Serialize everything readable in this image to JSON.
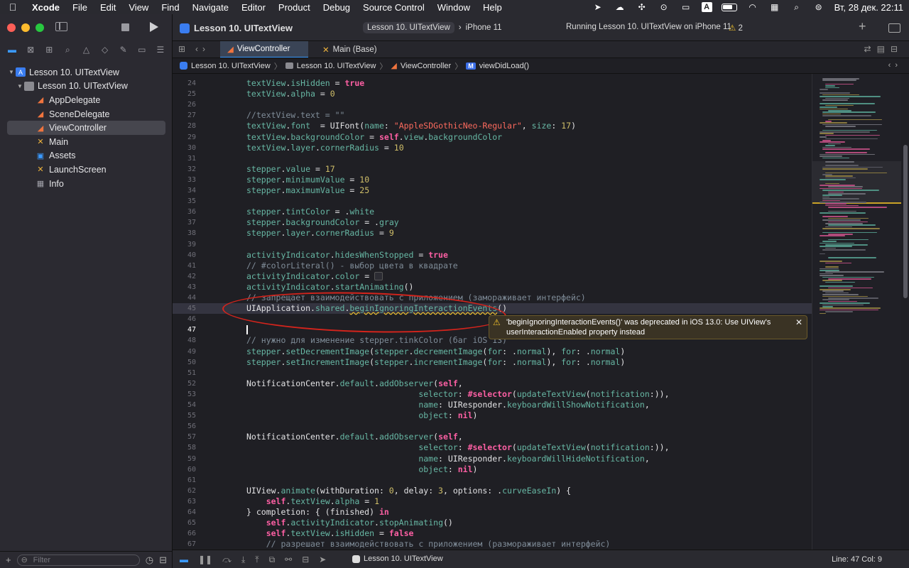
{
  "menubar": {
    "app": "Xcode",
    "items": [
      "File",
      "Edit",
      "View",
      "Find",
      "Navigate",
      "Editor",
      "Product",
      "Debug",
      "Source Control",
      "Window",
      "Help"
    ],
    "input_badge": "A",
    "datetime": "Вт, 28 дек.  22:11"
  },
  "sidebar": {
    "tree": [
      {
        "label": "Lesson 10. UITextView",
        "icon": "project-icon",
        "disclosure": "▼"
      },
      {
        "label": "Lesson 10. UITextView",
        "icon": "folder-icon",
        "disclosure": "▼"
      },
      {
        "label": "AppDelegate",
        "icon": "swift-file-icon"
      },
      {
        "label": "SceneDelegate",
        "icon": "swift-file-icon"
      },
      {
        "label": "ViewController",
        "icon": "swift-file-icon",
        "selected": true
      },
      {
        "label": "Main",
        "icon": "storyboard-icon"
      },
      {
        "label": "Assets",
        "icon": "assets-icon"
      },
      {
        "label": "LaunchScreen",
        "icon": "storyboard-icon"
      },
      {
        "label": "Info",
        "icon": "plist-icon"
      }
    ],
    "filter_placeholder": "Filter"
  },
  "toolbar": {
    "project_title": "Lesson 10. UITextView",
    "scheme": "Lesson 10. UITextView",
    "device": "iPhone 11",
    "status": "Running Lesson 10. UITextView on iPhone 11",
    "warnings": "2"
  },
  "tabs": {
    "active": "ViewController",
    "other": "Main (Base)"
  },
  "breadcrumb": {
    "items": [
      "Lesson 10. UITextView",
      "Lesson 10. UITextView",
      "ViewController",
      "viewDidLoad()"
    ],
    "method_badge": "M"
  },
  "code_lines": [
    {
      "n": "24",
      "html": "<span class='prop'>textView</span>.<span class='prop'>isHidden</span> = <span class='kw'>true</span>"
    },
    {
      "n": "25",
      "html": "<span class='prop'>textView</span>.<span class='prop'>alpha</span> = <span class='num'>0</span>"
    },
    {
      "n": "26",
      "html": ""
    },
    {
      "n": "27",
      "html": "<span class='cmt'>//textView.text = \"\"</span>"
    },
    {
      "n": "28",
      "html": "<span class='prop'>textView</span>.<span class='prop'>font</span>  = UIFont(<span class='fn'>name</span>: <span class='str'>\"AppleSDGothicNeo-Regular\"</span>, <span class='fn'>size</span>: <span class='num'>17</span>)"
    },
    {
      "n": "29",
      "html": "<span class='prop'>textView</span>.<span class='prop'>backgroundColor</span> = <span class='kw'>self</span>.<span class='prop'>view</span>.<span class='prop'>backgroundColor</span>"
    },
    {
      "n": "30",
      "html": "<span class='prop'>textView</span>.<span class='prop'>layer</span>.<span class='prop'>cornerRadius</span> = <span class='num'>10</span>"
    },
    {
      "n": "31",
      "html": ""
    },
    {
      "n": "32",
      "html": "<span class='prop'>stepper</span>.<span class='prop'>value</span> = <span class='num'>17</span>"
    },
    {
      "n": "33",
      "html": "<span class='prop'>stepper</span>.<span class='prop'>minimumValue</span> = <span class='num'>10</span>"
    },
    {
      "n": "34",
      "html": "<span class='prop'>stepper</span>.<span class='prop'>maximumValue</span> = <span class='num'>25</span>"
    },
    {
      "n": "35",
      "html": ""
    },
    {
      "n": "36",
      "html": "<span class='prop'>stepper</span>.<span class='prop'>tintColor</span> = .<span class='prop'>white</span>"
    },
    {
      "n": "37",
      "html": "<span class='prop'>stepper</span>.<span class='prop'>backgroundColor</span> = .<span class='prop'>gray</span>"
    },
    {
      "n": "38",
      "html": "<span class='prop'>stepper</span>.<span class='prop'>layer</span>.<span class='prop'>cornerRadius</span> = <span class='num'>9</span>"
    },
    {
      "n": "39",
      "html": ""
    },
    {
      "n": "40",
      "html": "<span class='prop'>activityIndicator</span>.<span class='prop'>hidesWhenStopped</span> = <span class='kw'>true</span>"
    },
    {
      "n": "41",
      "html": "<span class='cmt'>// #colorLiteral() - выбор цвета в квадрате</span>"
    },
    {
      "n": "42",
      "html": "<span class='prop'>activityIndicator</span>.<span class='prop'>color</span> = <span class='colorwell'></span>"
    },
    {
      "n": "43",
      "html": "<span class='prop'>activityIndicator</span>.<span class='fn'>startAnimating</span>()"
    },
    {
      "n": "44",
      "html": "<span class='cmt'>// запрещает взаимодействовать с приложением (замораживает интерфейс)</span>"
    },
    {
      "n": "45",
      "html": "UIApplication.<span class='prop'>shared</span>.<span class='fn' style='text-decoration:underline wavy #f3c32b'>beginIgnoringInteractionEvents</span>()",
      "hl": true
    },
    {
      "n": "46",
      "html": ""
    },
    {
      "n": "47",
      "html": "<span class='cursor'></span>",
      "cur": true
    },
    {
      "n": "48",
      "html": "<span class='cmt'>// нужно для изменение stepper.tinkColor (баг iOS 13)</span>"
    },
    {
      "n": "49",
      "html": "<span class='prop'>stepper</span>.<span class='fn'>setDecrementImage</span>(<span class='prop'>stepper</span>.<span class='fn'>decrementImage</span>(<span class='fn'>for</span>: .<span class='prop'>normal</span>), <span class='fn'>for</span>: .<span class='prop'>normal</span>)"
    },
    {
      "n": "50",
      "html": "<span class='prop'>stepper</span>.<span class='fn'>setIncrementImage</span>(<span class='prop'>stepper</span>.<span class='fn'>incrementImage</span>(<span class='fn'>for</span>: .<span class='prop'>normal</span>), <span class='fn'>for</span>: .<span class='prop'>normal</span>)"
    },
    {
      "n": "51",
      "html": ""
    },
    {
      "n": "52",
      "html": "NotificationCenter.<span class='prop'>default</span>.<span class='fn'>addObserver</span>(<span class='kw'>self</span>,"
    },
    {
      "n": "53",
      "html": "                                   <span class='fn'>selector</span>: <span class='kw'>#selector</span>(<span class='fn'>updateTextView</span>(<span class='fn'>notification</span>:)),"
    },
    {
      "n": "54",
      "html": "                                   <span class='fn'>name</span>: UIResponder.<span class='prop'>keyboardWillShowNotification</span>,"
    },
    {
      "n": "55",
      "html": "                                   <span class='fn'>object</span>: <span class='kw'>nil</span>)"
    },
    {
      "n": "56",
      "html": ""
    },
    {
      "n": "57",
      "html": "NotificationCenter.<span class='prop'>default</span>.<span class='fn'>addObserver</span>(<span class='kw'>self</span>,"
    },
    {
      "n": "58",
      "html": "                                   <span class='fn'>selector</span>: <span class='kw'>#selector</span>(<span class='fn'>updateTextView</span>(<span class='fn'>notification</span>:)),"
    },
    {
      "n": "59",
      "html": "                                   <span class='fn'>name</span>: UIResponder.<span class='prop'>keyboardWillHideNotification</span>,"
    },
    {
      "n": "60",
      "html": "                                   <span class='fn'>object</span>: <span class='kw'>nil</span>)"
    },
    {
      "n": "61",
      "html": ""
    },
    {
      "n": "62",
      "html": "UIView.<span class='fn'>animate</span>(withDuration: <span class='num'>0</span>, delay: <span class='num'>3</span>, options: .<span class='prop'>curveEaseIn</span>) {"
    },
    {
      "n": "63",
      "html": "    <span class='kw'>self</span>.<span class='prop'>textView</span>.<span class='prop'>alpha</span> = <span class='num'>1</span>"
    },
    {
      "n": "64",
      "html": "} completion: { (finished) <span class='kw'>in</span>"
    },
    {
      "n": "65",
      "html": "    <span class='kw'>self</span>.<span class='prop'>activityIndicator</span>.<span class='fn'>stopAnimating</span>()"
    },
    {
      "n": "66",
      "html": "    <span class='kw'>self</span>.<span class='prop'>textView</span>.<span class='prop'>isHidden</span> = <span class='kw'>false</span>"
    },
    {
      "n": "67",
      "html": "    <span class='cmt'>// разрешает взаимодействовать с приложением (размораживает интерфейс)</span>"
    }
  ],
  "issue": {
    "text": "'beginIgnoringInteractionEvents()' was deprecated in iOS 13.0: Use UIView's userInteractionEnabled property instead"
  },
  "statusbar": {
    "target": "Lesson 10. UITextView",
    "position": "Line: 47  Col: 9"
  },
  "colors": {
    "accent": "#3b9aff",
    "warning": "#f3c32b",
    "annotation": "#d4241c"
  }
}
